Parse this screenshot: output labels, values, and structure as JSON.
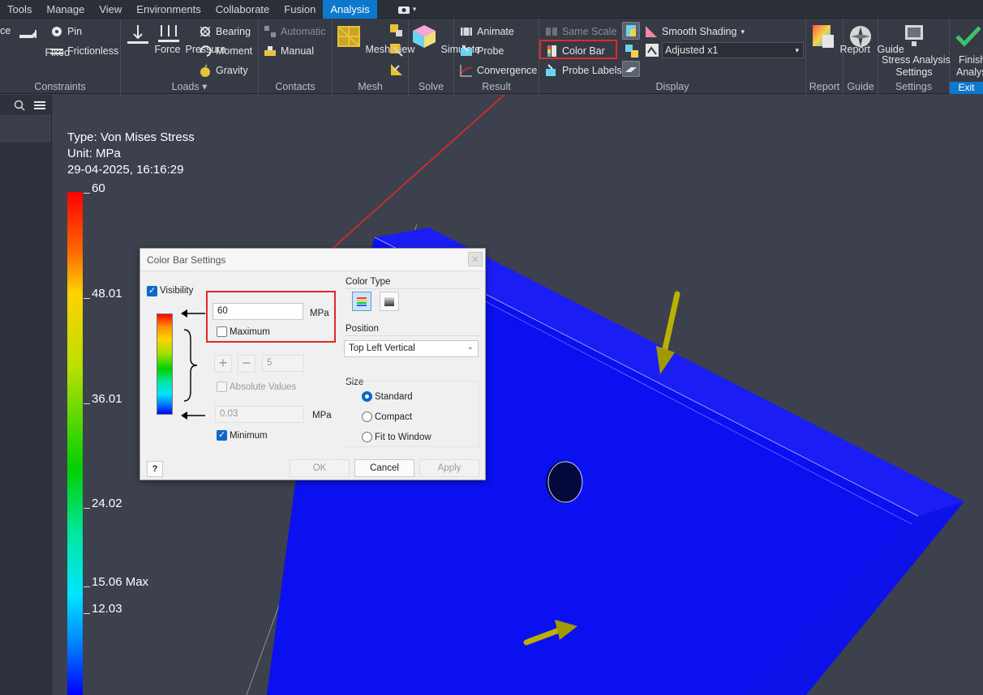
{
  "menubar": {
    "items": [
      "Tools",
      "Manage",
      "View",
      "Environments",
      "Collaborate",
      "Fusion",
      "Analysis"
    ],
    "active": "Analysis"
  },
  "ribbon": {
    "constraints": {
      "title": "Constraints",
      "cut_label": "ce",
      "fixed": "Fixed",
      "pin": "Pin",
      "frictionless": "Frictionless"
    },
    "loads": {
      "title": "Loads",
      "force": "Force",
      "pressure": "Pressure",
      "bearing": "Bearing",
      "moment": "Moment",
      "gravity": "Gravity"
    },
    "contacts": {
      "title": "Contacts",
      "automatic": "Automatic",
      "manual": "Manual"
    },
    "mesh": {
      "title": "Mesh",
      "mesh_view": "Mesh View"
    },
    "solve": {
      "title": "Solve",
      "simulate": "Simulate"
    },
    "result": {
      "title": "Result",
      "animate": "Animate",
      "probe": "Probe",
      "convergence": "Convergence"
    },
    "display": {
      "title": "Display",
      "same_scale": "Same Scale",
      "color_bar": "Color Bar",
      "probe_labels": "Probe Labels",
      "smooth_shading": "Smooth Shading",
      "adjusted": "Adjusted x1"
    },
    "report": {
      "title": "Report",
      "report": "Report"
    },
    "guide": {
      "title": "Guide",
      "guide": "Guide"
    },
    "settings": {
      "title": "Settings",
      "stress_line1": "Stress Analysis",
      "stress_line2": "Settings"
    },
    "exit": {
      "title": "Exit",
      "finish_line1": "Finish",
      "finish_line2": "Analysis"
    }
  },
  "legend": {
    "type": "Type: Von Mises Stress",
    "unit": "Unit: MPa",
    "timestamp": "29-04-2025, 16:16:29",
    "labels": [
      "60",
      "48.01",
      "36.01",
      "24.02",
      "15.06 Max",
      "12.03"
    ]
  },
  "dialog": {
    "title": "Color Bar Settings",
    "visibility": "Visibility",
    "max_value": "60",
    "max_unit": "MPa",
    "maximum": "Maximum",
    "steps": "5",
    "absolute_values": "Absolute Values",
    "min_value": "0.03",
    "min_unit": "MPa",
    "minimum": "Minimum",
    "color_type": "Color Type",
    "position_label": "Position",
    "position_value": "Top Left Vertical",
    "size_label": "Size",
    "size_standard": "Standard",
    "size_compact": "Compact",
    "size_fit": "Fit to Window",
    "ok": "OK",
    "cancel": "Cancel",
    "apply": "Apply"
  },
  "colors": {
    "accent": "#0d79cc",
    "highlight": "#e02a2a",
    "model_blue": "#0a10f0"
  }
}
